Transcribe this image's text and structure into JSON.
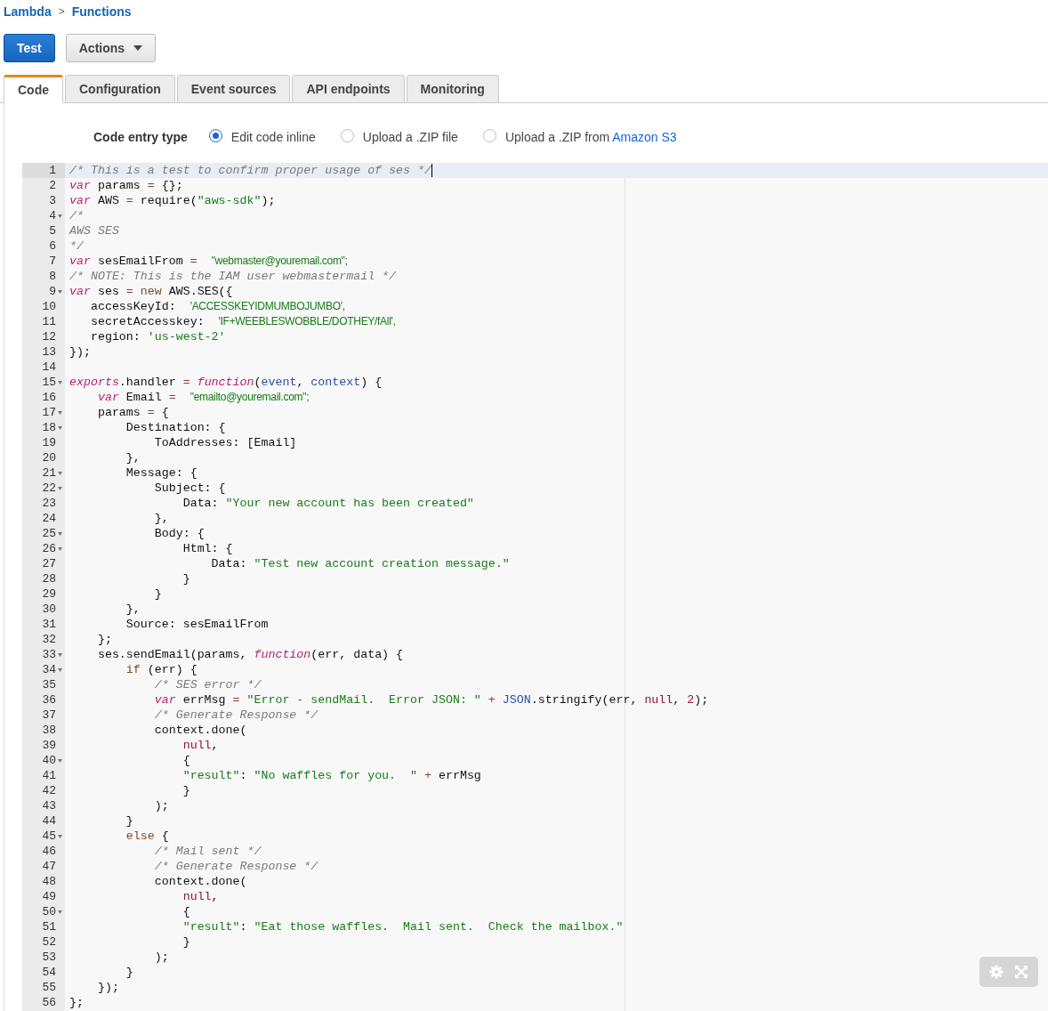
{
  "breadcrumb": [
    {
      "label": "Lambda"
    },
    {
      "label": "Functions"
    }
  ],
  "breadcrumb_separator": ">",
  "toolbar": {
    "test_button": "Test",
    "actions_button": "Actions"
  },
  "tabs": [
    {
      "label": "Code",
      "selected": true
    },
    {
      "label": "Configuration",
      "selected": false
    },
    {
      "label": "Event sources",
      "selected": false
    },
    {
      "label": "API endpoints",
      "selected": false
    },
    {
      "label": "Monitoring",
      "selected": false
    }
  ],
  "code_entry": {
    "label": "Code entry type",
    "options": [
      {
        "label": "Edit code inline",
        "selected": true
      },
      {
        "label": "Upload a .ZIP file",
        "selected": false
      },
      {
        "label": "Upload a .ZIP from",
        "link": "Amazon S3",
        "selected": false
      }
    ]
  },
  "editor": {
    "lines": [
      {
        "number": "1",
        "foldable": false,
        "active": true,
        "tokens": [
          {
            "kind": "comment",
            "text": "/* This is a test to confirm proper usage of ses */"
          }
        ]
      },
      {
        "number": "2",
        "foldable": false,
        "active": false,
        "tokens": [
          {
            "kind": "keyword",
            "text": "var"
          },
          {
            "kind": "plain",
            "text": " params "
          },
          {
            "kind": "operator",
            "text": "="
          },
          {
            "kind": "plain",
            "text": " {};"
          }
        ]
      },
      {
        "number": "3",
        "foldable": false,
        "active": false,
        "tokens": [
          {
            "kind": "keyword",
            "text": "var"
          },
          {
            "kind": "plain",
            "text": " AWS "
          },
          {
            "kind": "operator",
            "text": "="
          },
          {
            "kind": "plain",
            "text": " require("
          },
          {
            "kind": "string",
            "text": "\"aws-sdk\""
          },
          {
            "kind": "plain",
            "text": ");"
          }
        ]
      },
      {
        "number": "4",
        "foldable": true,
        "active": false,
        "tokens": [
          {
            "kind": "comment",
            "text": "/*"
          }
        ]
      },
      {
        "number": "5",
        "foldable": false,
        "active": false,
        "tokens": [
          {
            "kind": "comment",
            "text": "AWS SES"
          }
        ]
      },
      {
        "number": "6",
        "foldable": false,
        "active": false,
        "tokens": [
          {
            "kind": "comment",
            "text": "*/"
          }
        ]
      },
      {
        "number": "7",
        "foldable": false,
        "active": false,
        "tokens": [
          {
            "kind": "keyword",
            "text": "var"
          },
          {
            "kind": "plain",
            "text": " sesEmailFrom "
          },
          {
            "kind": "operator",
            "text": "=  "
          },
          {
            "kind": "sans_string",
            "text": "\"webmaster@youremail.com\";"
          }
        ]
      },
      {
        "number": "8",
        "foldable": false,
        "active": false,
        "tokens": [
          {
            "kind": "comment",
            "text": "/* NOTE: This is the IAM user webmastermail */"
          }
        ]
      },
      {
        "number": "9",
        "foldable": true,
        "active": false,
        "tokens": [
          {
            "kind": "keyword",
            "text": "var"
          },
          {
            "kind": "plain",
            "text": " ses "
          },
          {
            "kind": "operator",
            "text": "= "
          },
          {
            "kind": "control",
            "text": "new"
          },
          {
            "kind": "plain",
            "text": " AWS.SES({"
          }
        ]
      },
      {
        "number": "10",
        "foldable": false,
        "active": false,
        "tokens": [
          {
            "kind": "plain",
            "text": "   accessKeyId:  "
          },
          {
            "kind": "sans_string",
            "text": "'ACCESSKEYIDMUMBOJUMBO'"
          },
          {
            "kind": "sans_plain",
            "text": ","
          }
        ]
      },
      {
        "number": "11",
        "foldable": false,
        "active": false,
        "tokens": [
          {
            "kind": "plain",
            "text": "   secretAccesskey:  "
          },
          {
            "kind": "sans_string",
            "text": "'IF+WEEBLESWOBBLE/DOTHEY/fAll'"
          },
          {
            "kind": "sans_plain",
            "text": ","
          }
        ]
      },
      {
        "number": "12",
        "foldable": false,
        "active": false,
        "tokens": [
          {
            "kind": "plain",
            "text": "   region: "
          },
          {
            "kind": "string",
            "text": "'us-west-2'"
          }
        ]
      },
      {
        "number": "13",
        "foldable": false,
        "active": false,
        "tokens": [
          {
            "kind": "plain",
            "text": "});"
          }
        ]
      },
      {
        "number": "14",
        "foldable": false,
        "active": false
      },
      {
        "number": "15",
        "foldable": true,
        "active": false,
        "tokens": [
          {
            "kind": "keyword",
            "text": "exports"
          },
          {
            "kind": "plain",
            "text": ".handler "
          },
          {
            "kind": "operator",
            "text": "= "
          },
          {
            "kind": "keyword",
            "text": "function"
          },
          {
            "kind": "plain",
            "text": "("
          },
          {
            "kind": "variable",
            "text": "event"
          },
          {
            "kind": "plain",
            "text": ", "
          },
          {
            "kind": "variable",
            "text": "context"
          },
          {
            "kind": "plain",
            "text": ") {"
          }
        ]
      },
      {
        "number": "16",
        "foldable": false,
        "active": false,
        "tokens": [
          {
            "kind": "keyword",
            "text": "    var"
          },
          {
            "kind": "plain",
            "text": " Email "
          },
          {
            "kind": "operator",
            "text": "=  "
          },
          {
            "kind": "sans_string",
            "text": "\"emailto@youremail.com\";"
          }
        ]
      },
      {
        "number": "17",
        "foldable": true,
        "active": false,
        "tokens": [
          {
            "kind": "plain",
            "text": "    params "
          },
          {
            "kind": "operator",
            "text": "="
          },
          {
            "kind": "plain",
            "text": " {"
          }
        ]
      },
      {
        "number": "18",
        "foldable": true,
        "active": false,
        "tokens": [
          {
            "kind": "plain",
            "text": "        Destination: {"
          }
        ]
      },
      {
        "number": "19",
        "foldable": false,
        "active": false,
        "tokens": [
          {
            "kind": "plain",
            "text": "            ToAddresses: [Email]"
          }
        ]
      },
      {
        "number": "20",
        "foldable": false,
        "active": false,
        "tokens": [
          {
            "kind": "plain",
            "text": "        },"
          }
        ]
      },
      {
        "number": "21",
        "foldable": true,
        "active": false,
        "tokens": [
          {
            "kind": "plain",
            "text": "        Message: {"
          }
        ]
      },
      {
        "number": "22",
        "foldable": true,
        "active": false,
        "tokens": [
          {
            "kind": "plain",
            "text": "            Subject: {"
          }
        ]
      },
      {
        "number": "23",
        "foldable": false,
        "active": false,
        "tokens": [
          {
            "kind": "plain",
            "text": "                Data: "
          },
          {
            "kind": "string",
            "text": "\"Your new account has been created\""
          }
        ]
      },
      {
        "number": "24",
        "foldable": false,
        "active": false,
        "tokens": [
          {
            "kind": "plain",
            "text": "            },"
          }
        ]
      },
      {
        "number": "25",
        "foldable": true,
        "active": false,
        "tokens": [
          {
            "kind": "plain",
            "text": "            Body: {"
          }
        ]
      },
      {
        "number": "26",
        "foldable": true,
        "active": false,
        "tokens": [
          {
            "kind": "plain",
            "text": "                Html: {"
          }
        ]
      },
      {
        "number": "27",
        "foldable": false,
        "active": false,
        "tokens": [
          {
            "kind": "plain",
            "text": "                    Data: "
          },
          {
            "kind": "string",
            "text": "\"Test new account creation message.\""
          }
        ]
      },
      {
        "number": "28",
        "foldable": false,
        "active": false,
        "tokens": [
          {
            "kind": "plain",
            "text": "                }"
          }
        ]
      },
      {
        "number": "29",
        "foldable": false,
        "active": false,
        "tokens": [
          {
            "kind": "plain",
            "text": "            }"
          }
        ]
      },
      {
        "number": "30",
        "foldable": false,
        "active": false,
        "tokens": [
          {
            "kind": "plain",
            "text": "        },"
          }
        ]
      },
      {
        "number": "31",
        "foldable": false,
        "active": false,
        "tokens": [
          {
            "kind": "plain",
            "text": "        Source: sesEmailFrom"
          }
        ]
      },
      {
        "number": "32",
        "foldable": false,
        "active": false,
        "tokens": [
          {
            "kind": "plain",
            "text": "    };"
          }
        ]
      },
      {
        "number": "33",
        "foldable": true,
        "active": false,
        "tokens": [
          {
            "kind": "plain",
            "text": "    ses.sendEmail(params, "
          },
          {
            "kind": "keyword",
            "text": "function"
          },
          {
            "kind": "plain",
            "text": "(err, data) {"
          }
        ]
      },
      {
        "number": "34",
        "foldable": true,
        "active": false,
        "tokens": [
          {
            "kind": "control",
            "text": "        if"
          },
          {
            "kind": "plain",
            "text": " (err) {"
          }
        ]
      },
      {
        "number": "35",
        "foldable": false,
        "active": false,
        "tokens": [
          {
            "kind": "comment",
            "text": "            /* SES error */"
          }
        ]
      },
      {
        "number": "36",
        "foldable": false,
        "active": false,
        "tokens": [
          {
            "kind": "keyword",
            "text": "            var"
          },
          {
            "kind": "plain",
            "text": " errMsg "
          },
          {
            "kind": "operator",
            "text": "= "
          },
          {
            "kind": "string",
            "text": "\"Error - sendMail.  Error JSON: \""
          },
          {
            "kind": "operator",
            "text": " + "
          },
          {
            "kind": "variable",
            "text": "JSON"
          },
          {
            "kind": "plain",
            "text": ".stringify(err, "
          },
          {
            "kind": "atom",
            "text": "null"
          },
          {
            "kind": "plain",
            "text": ", "
          },
          {
            "kind": "atom",
            "text": "2"
          },
          {
            "kind": "plain",
            "text": ");"
          }
        ]
      },
      {
        "number": "37",
        "foldable": false,
        "active": false,
        "tokens": [
          {
            "kind": "comment",
            "text": "            /* Generate Response */"
          }
        ]
      },
      {
        "number": "38",
        "foldable": false,
        "active": false,
        "tokens": [
          {
            "kind": "plain",
            "text": "            context.done("
          }
        ]
      },
      {
        "number": "39",
        "foldable": false,
        "active": false,
        "tokens": [
          {
            "kind": "atom",
            "text": "                null"
          },
          {
            "kind": "plain",
            "text": ","
          }
        ]
      },
      {
        "number": "40",
        "foldable": true,
        "active": false,
        "tokens": [
          {
            "kind": "plain",
            "text": "                {"
          }
        ]
      },
      {
        "number": "41",
        "foldable": false,
        "active": false,
        "tokens": [
          {
            "kind": "string",
            "text": "                \"result\""
          },
          {
            "kind": "plain",
            "text": ": "
          },
          {
            "kind": "string",
            "text": "\"No waffles for you.  \""
          },
          {
            "kind": "operator",
            "text": " + "
          },
          {
            "kind": "plain",
            "text": "errMsg"
          }
        ]
      },
      {
        "number": "42",
        "foldable": false,
        "active": false,
        "tokens": [
          {
            "kind": "plain",
            "text": "                }"
          }
        ]
      },
      {
        "number": "43",
        "foldable": false,
        "active": false,
        "tokens": [
          {
            "kind": "plain",
            "text": "            );"
          }
        ]
      },
      {
        "number": "44",
        "foldable": false,
        "active": false,
        "tokens": [
          {
            "kind": "plain",
            "text": "        }"
          }
        ]
      },
      {
        "number": "45",
        "foldable": true,
        "active": false,
        "tokens": [
          {
            "kind": "control",
            "text": "        else"
          },
          {
            "kind": "plain",
            "text": " {"
          }
        ]
      },
      {
        "number": "46",
        "foldable": false,
        "active": false,
        "tokens": [
          {
            "kind": "comment",
            "text": "            /* Mail sent */"
          }
        ]
      },
      {
        "number": "47",
        "foldable": false,
        "active": false,
        "tokens": [
          {
            "kind": "comment",
            "text": "            /* Generate Response */"
          }
        ]
      },
      {
        "number": "48",
        "foldable": false,
        "active": false,
        "tokens": [
          {
            "kind": "plain",
            "text": "            context.done("
          }
        ]
      },
      {
        "number": "49",
        "foldable": false,
        "active": false,
        "tokens": [
          {
            "kind": "atom",
            "text": "                null"
          },
          {
            "kind": "plain",
            "text": ","
          }
        ]
      },
      {
        "number": "50",
        "foldable": true,
        "active": false,
        "tokens": [
          {
            "kind": "plain",
            "text": "                {"
          }
        ]
      },
      {
        "number": "51",
        "foldable": false,
        "active": false,
        "tokens": [
          {
            "kind": "string",
            "text": "                \"result\""
          },
          {
            "kind": "plain",
            "text": ": "
          },
          {
            "kind": "string",
            "text": "\"Eat those waffles.  Mail sent.  Check the mailbox.\""
          }
        ]
      },
      {
        "number": "52",
        "foldable": false,
        "active": false,
        "tokens": [
          {
            "kind": "plain",
            "text": "                }"
          }
        ]
      },
      {
        "number": "53",
        "foldable": false,
        "active": false,
        "tokens": [
          {
            "kind": "plain",
            "text": "            );"
          }
        ]
      },
      {
        "number": "54",
        "foldable": false,
        "active": false,
        "tokens": [
          {
            "kind": "plain",
            "text": "        }"
          }
        ]
      },
      {
        "number": "55",
        "foldable": false,
        "active": false,
        "tokens": [
          {
            "kind": "plain",
            "text": "    });"
          }
        ]
      },
      {
        "number": "56",
        "foldable": false,
        "active": false,
        "tokens": [
          {
            "kind": "plain",
            "text": "};"
          }
        ]
      }
    ]
  }
}
